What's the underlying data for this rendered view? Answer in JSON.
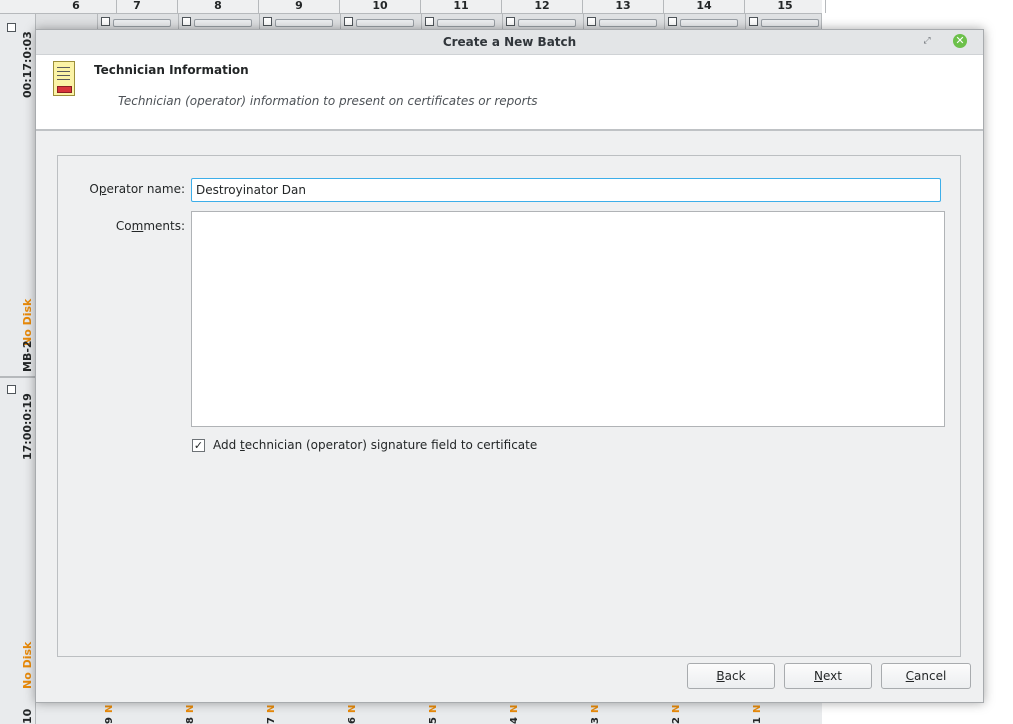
{
  "background_app": {
    "column_headers": [
      "6",
      "7",
      "8",
      "9",
      "10",
      "11",
      "12",
      "13",
      "14",
      "15"
    ],
    "slot_time_top": "00:17:0:03",
    "slot_name": "MB-2",
    "slot_status": "No Disk",
    "slot_time_mid": "17:00:0:19",
    "bottom_status": "No Disk",
    "bottom_slot_number": "10",
    "bottom_digits": [
      "9",
      "8",
      "7",
      "6",
      "5",
      "4",
      "3",
      "2",
      "1"
    ],
    "bottom_status_letter": "N"
  },
  "dialog": {
    "title": "Create a New Batch",
    "header": {
      "title": "Technician Information",
      "subtitle": "Technician (operator) information to present on certificates or reports",
      "icon": "report-document-icon"
    },
    "form": {
      "operator_label_pre": "O",
      "operator_label_mnemonic": "p",
      "operator_label_post": "erator name:",
      "operator_value": "Destroyinator Dan",
      "comments_label_pre": "Co",
      "comments_label_mnemonic": "m",
      "comments_label_post": "ments:",
      "comments_value": "",
      "signature_checked": true,
      "signature_label_pre": "Add ",
      "signature_label_mnemonic": "t",
      "signature_label_post": "echnician (operator) signature field to certificate"
    },
    "buttons": {
      "back_mnemonic": "B",
      "back_rest": "ack",
      "next_mnemonic": "N",
      "next_rest": "ext",
      "cancel_mnemonic": "C",
      "cancel_rest": "ancel"
    }
  }
}
